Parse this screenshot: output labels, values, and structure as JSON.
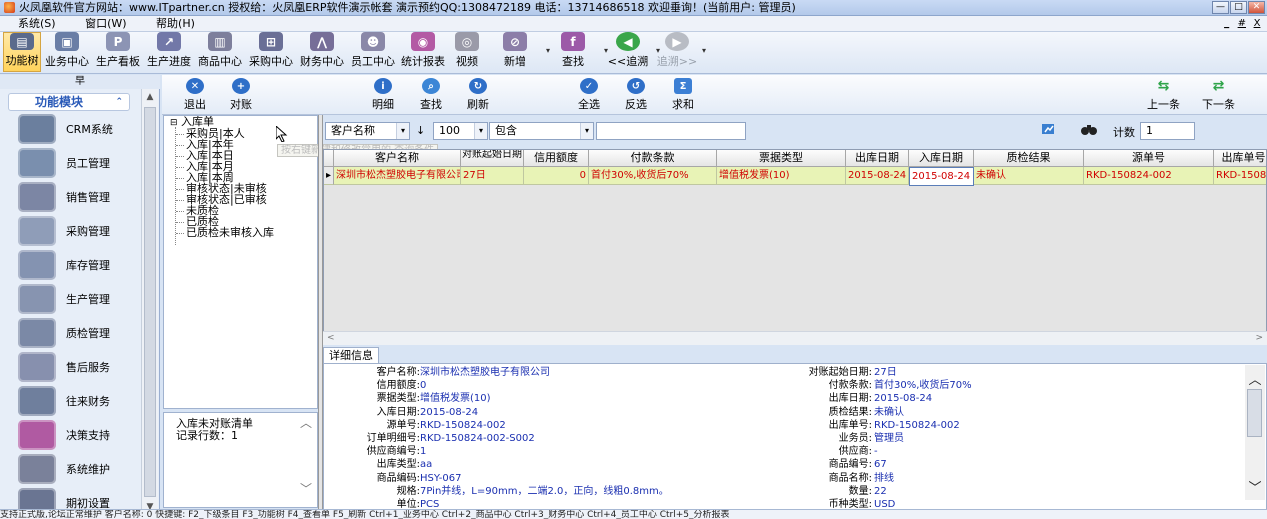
{
  "window": {
    "title": "火凤凰软件官方网站：www.ITpartner.cn  授权给：火凤凰ERP软件演示帐套 演示预约QQ:1308472189 电话：13714686518 欢迎垂询！(当前用户: 管理员)",
    "btn_min": "—",
    "btn_max": "□",
    "btn_close": "✕"
  },
  "menubar": {
    "items": [
      "系统(S)",
      "窗口(W)",
      "帮助(H)"
    ],
    "mdi": [
      "_",
      "#",
      "X"
    ]
  },
  "main_toolbar": [
    {
      "label": "功能树",
      "icon": "function-tree-icon",
      "color": "#5a6a8c",
      "glyph": "▤"
    },
    {
      "label": "业务中心",
      "icon": "business-center-icon",
      "color": "#6a7ea6",
      "glyph": "▣"
    },
    {
      "label": "生产看板",
      "icon": "production-board-icon",
      "color": "#8c94b4",
      "glyph": "P"
    },
    {
      "label": "生产进度",
      "icon": "production-progress-icon",
      "color": "#7278a8",
      "glyph": "↗"
    },
    {
      "label": "商品中心",
      "icon": "goods-center-icon",
      "color": "#7d7f9c",
      "glyph": "▥"
    },
    {
      "label": "采购中心",
      "icon": "purchase-center-icon",
      "color": "#6a6f96",
      "glyph": "⊞"
    },
    {
      "label": "财务中心",
      "icon": "finance-center-icon",
      "color": "#766e98",
      "glyph": "⋀"
    },
    {
      "label": "员工中心",
      "icon": "staff-center-icon",
      "color": "#8a88a8",
      "glyph": "☻"
    },
    {
      "label": "统计报表",
      "icon": "report-icon",
      "color": "#b35aa4",
      "glyph": "◉"
    },
    {
      "label": "视频",
      "icon": "video-icon",
      "color": "#9a9aa8",
      "glyph": "◎"
    },
    {
      "label": "新增",
      "icon": "add-new-icon",
      "color": "#8c7ea8",
      "glyph": "⊘"
    },
    {
      "label": "查找",
      "icon": "find-icon",
      "color": "#9c5aa8",
      "glyph": "f"
    },
    {
      "label": "<<追溯",
      "icon": "trace-back-icon",
      "color": "#3aa64a",
      "glyph": "◀"
    },
    {
      "label": "追溯>>",
      "icon": "trace-forward-icon",
      "color": "#b8bcc4",
      "glyph": "▶"
    }
  ],
  "sub_toolbar": [
    {
      "label": "退出",
      "icon": "exit-icon",
      "color": "#2f6fc8",
      "glyph": "✕"
    },
    {
      "label": "对账",
      "icon": "reconcile-icon",
      "color": "#2f6fc8",
      "glyph": "+"
    },
    {
      "label": "明细",
      "icon": "detail-icon",
      "color": "#2f6fc8",
      "glyph": "i"
    },
    {
      "label": "查找",
      "icon": "search-icon",
      "color": "#3c86d6",
      "glyph": "⌕"
    },
    {
      "label": "刷新",
      "icon": "refresh-icon",
      "color": "#2f6fc8",
      "glyph": "↻"
    },
    {
      "label": "全选",
      "icon": "select-all-icon",
      "color": "#2f6fc8",
      "glyph": "✓"
    },
    {
      "label": "反选",
      "icon": "invert-select-icon",
      "color": "#2f6fc8",
      "glyph": "↺"
    },
    {
      "label": "求和",
      "icon": "sum-icon",
      "color": "#3c7fd4",
      "glyph": "Σ"
    },
    {
      "label": "上一条",
      "icon": "prev-record-icon",
      "color": "#2fa44a",
      "glyph": "⇆"
    },
    {
      "label": "下一条",
      "icon": "next-record-icon",
      "color": "#2fa44a",
      "glyph": "⇄"
    }
  ],
  "left_panel": {
    "header": "早",
    "title": "功能模块",
    "modules": [
      {
        "label": "CRM系统",
        "icon": "crm-icon",
        "color": "#6b7f9e"
      },
      {
        "label": "员工管理",
        "icon": "staff-management-icon",
        "color": "#7a8fae"
      },
      {
        "label": "销售管理",
        "icon": "sales-management-icon",
        "color": "#7c86a4"
      },
      {
        "label": "采购管理",
        "icon": "purchase-management-icon",
        "color": "#8f9db8"
      },
      {
        "label": "库存管理",
        "icon": "inventory-management-icon",
        "color": "#8493b1"
      },
      {
        "label": "生产管理",
        "icon": "production-management-icon",
        "color": "#8794b0"
      },
      {
        "label": "质检管理",
        "icon": "quality-management-icon",
        "color": "#7b89a6"
      },
      {
        "label": "售后服务",
        "icon": "after-sales-icon",
        "color": "#8790ae"
      },
      {
        "label": "往来财务",
        "icon": "accounts-icon",
        "color": "#6f7f9d"
      },
      {
        "label": "决策支持",
        "icon": "decision-support-icon",
        "color": "#b05aa2"
      },
      {
        "label": "系统维护",
        "icon": "system-maintenance-icon",
        "color": "#7a819a"
      },
      {
        "label": "期初设置",
        "icon": "initial-setup-icon",
        "color": "#6a7592"
      }
    ]
  },
  "tree": {
    "root": "入库单",
    "nodes": [
      "采购员|本人",
      "入库|本年",
      "入库|本日",
      "入库|本月",
      "入库|本周",
      "审核状态|未审核",
      "审核状态|已审核",
      "未质检",
      "已质检",
      "已质检未审核入库"
    ],
    "tooltip": "按右键新建和修改常用的 查询条件"
  },
  "summary": {
    "title": "入库未对账清单",
    "rows_label": "记录行数：1"
  },
  "filter": {
    "field": "客户名称",
    "arrow": "↓",
    "top": "100",
    "op": "包含",
    "value": "",
    "count_label": "计数",
    "count_value": "1"
  },
  "grid": {
    "columns": [
      "客户名称",
      "对账起始日期",
      "信用额度",
      "付款条款",
      "票据类型",
      "出库日期",
      "入库日期",
      "质检结果",
      "源单号",
      "出库单号"
    ],
    "row_indicator": "▸",
    "rows": [
      [
        "深圳市松杰塑胶电子有限公司",
        "27日",
        "0",
        "首付30%,收货后70%",
        "增值税发票(10)",
        "2015-08-24",
        "2015-08-24",
        "未确认",
        "RKD-150824-002",
        "RKD-150824-002"
      ]
    ]
  },
  "detail": {
    "tab": "详细信息",
    "left": [
      {
        "label": "客户名称:",
        "value": "深圳市松杰塑胶电子有限公司"
      },
      {
        "label": "信用额度:",
        "value": "0"
      },
      {
        "label": "票据类型:",
        "value": "增值税发票(10)"
      },
      {
        "label": "入库日期:",
        "value": "2015-08-24"
      },
      {
        "label": "源单号:",
        "value": "RKD-150824-002"
      },
      {
        "label": "订单明细号:",
        "value": "RKD-150824-002-S002"
      },
      {
        "label": "供应商编号:",
        "value": "1"
      },
      {
        "label": "出库类型:",
        "value": "aa"
      },
      {
        "label": "商品编码:",
        "value": "HSY-067"
      },
      {
        "label": "规格:",
        "value": "7Pin并线，L=90mm，二端2.0，正向，线粗0.8mm。"
      },
      {
        "label": "单位:",
        "value": "PCS"
      }
    ],
    "right": [
      {
        "label": "对账起始日期:",
        "value": "27日"
      },
      {
        "label": "付款条款:",
        "value": "首付30%,收货后70%"
      },
      {
        "label": "出库日期:",
        "value": "2015-08-24"
      },
      {
        "label": "质检结果:",
        "value": "未确认"
      },
      {
        "label": "出库单号:",
        "value": "RKD-150824-002"
      },
      {
        "label": "业务员:",
        "value": "管理员"
      },
      {
        "label": "供应商:",
        "value": "-"
      },
      {
        "label": "商品编号:",
        "value": "67"
      },
      {
        "label": "商品名称:",
        "value": "排线"
      },
      {
        "label": "数量:",
        "value": "22"
      },
      {
        "label": "币种类型:",
        "value": "USD"
      }
    ]
  },
  "statusbar": "支持正式版,论坛正常维护  客户名称: 0  快捷键: F2_下级条目 F3_功能树 F4_查看单 F5_刷新 Ctrl+1_业务中心 Ctrl+2_商品中心 Ctrl+3_财务中心 Ctrl+4_员工中心 Ctrl+5_分析报表"
}
